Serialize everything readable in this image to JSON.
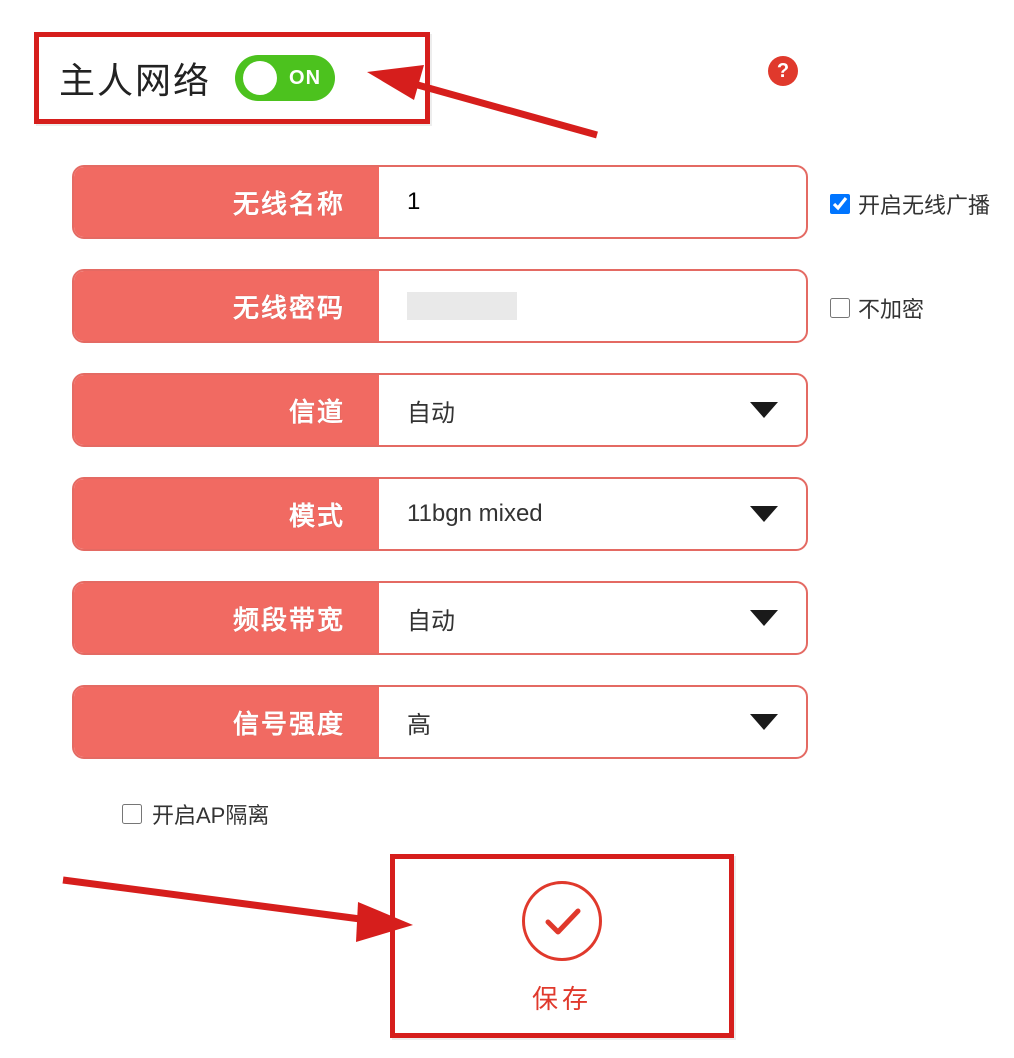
{
  "header": {
    "title": "主人网络",
    "toggle_state": "ON"
  },
  "help_icon": "?",
  "form": {
    "ssid": {
      "label": "无线名称",
      "value": "1"
    },
    "password": {
      "label": "无线密码",
      "value": ""
    },
    "channel": {
      "label": "信道",
      "value": "自动"
    },
    "mode": {
      "label": "模式",
      "value": "11bgn mixed"
    },
    "bandwidth": {
      "label": "频段带宽",
      "value": "自动"
    },
    "signal": {
      "label": "信号强度",
      "value": "高"
    }
  },
  "side": {
    "broadcast": {
      "label": "开启无线广播",
      "checked": true
    },
    "no_encrypt": {
      "label": "不加密",
      "checked": false
    }
  },
  "ap_isolation": {
    "label": "开启AP隔离",
    "checked": false
  },
  "save_label": "保存"
}
